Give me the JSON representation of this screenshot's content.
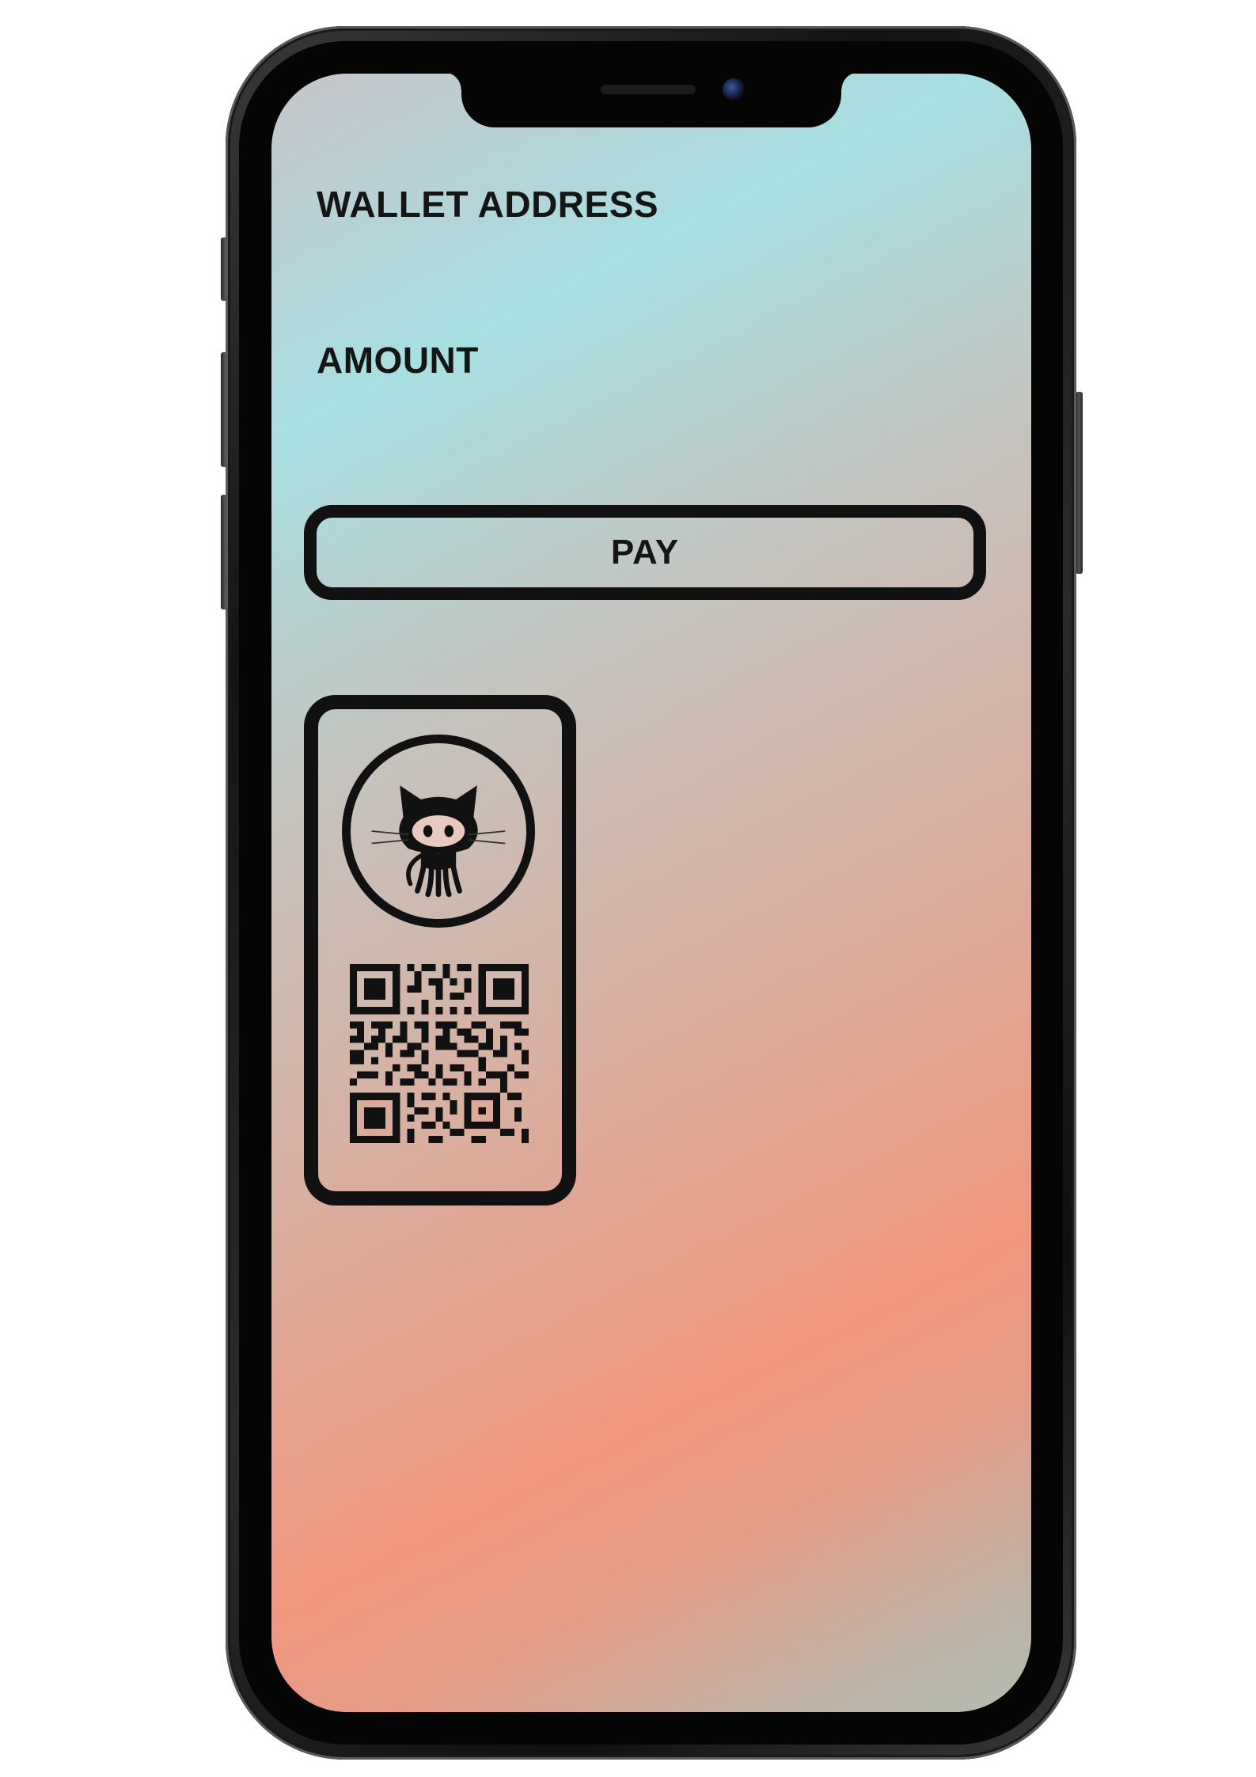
{
  "form": {
    "wallet_label": "WALLET ADDRESS",
    "amount_label": "AMOUNT",
    "pay_label": "PAY"
  },
  "card": {
    "avatar_icon": "octocat-icon",
    "qr_icon": "qr-code-icon"
  },
  "colors": {
    "ink": "#111111",
    "gradient_teal": "#a8dfe2",
    "gradient_salmon": "#f0977e"
  }
}
